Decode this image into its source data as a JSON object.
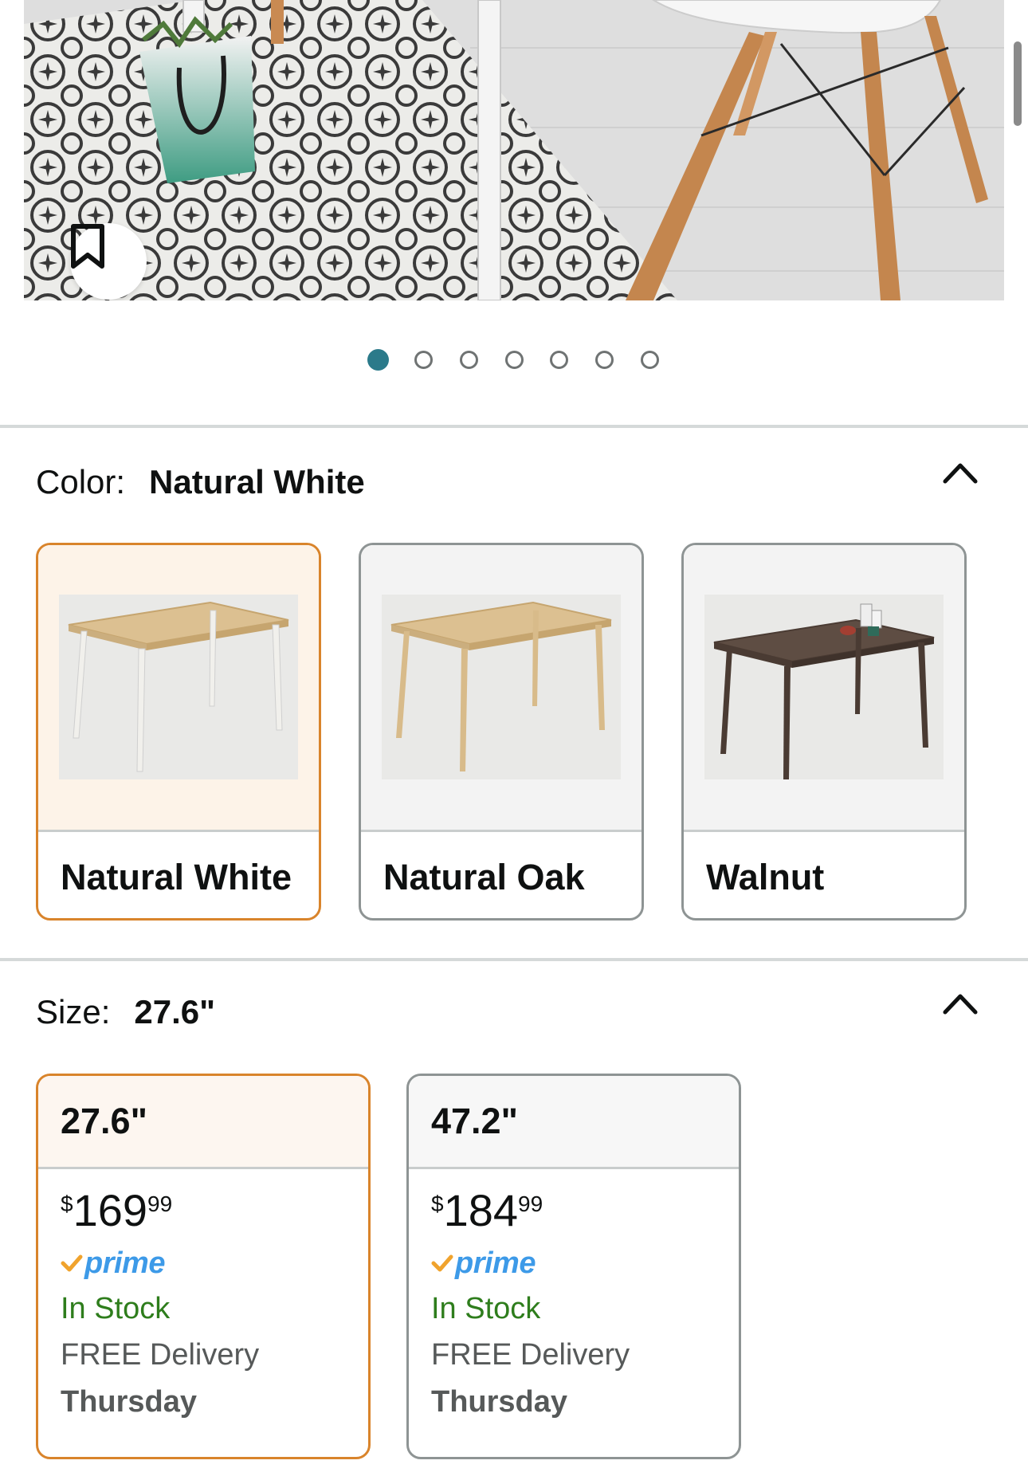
{
  "product": {
    "image_count": 7,
    "active_image": 1
  },
  "color": {
    "label": "Color:",
    "selected": "Natural White",
    "options": [
      {
        "name": "Natural White",
        "selected": true
      },
      {
        "name": "Natural Oak",
        "selected": false
      },
      {
        "name": "Walnut",
        "selected": false
      }
    ]
  },
  "size": {
    "label": "Size:",
    "selected": "27.6\"",
    "options": [
      {
        "name": "27.6\"",
        "selected": true,
        "price_currency": "$",
        "price_whole": "169",
        "price_fraction": "99",
        "prime": "prime",
        "stock": "In Stock",
        "delivery": "FREE Delivery",
        "delivery_day": "Thursday"
      },
      {
        "name": "47.2\"",
        "selected": false,
        "price_currency": "$",
        "price_whole": "184",
        "price_fraction": "99",
        "prime": "prime",
        "stock": "In Stock",
        "delivery": "FREE Delivery",
        "delivery_day": "Thursday"
      }
    ]
  },
  "colors": {
    "selected_border": "#d9842b",
    "active_dot": "#2b7a8a",
    "prime_blue": "#3d9ae8",
    "stock_green": "#2e7d1c"
  },
  "icons": {
    "bookmark": "bookmark-icon",
    "collapse": "chevron-up-icon",
    "prime_check": "prime-check-icon"
  }
}
